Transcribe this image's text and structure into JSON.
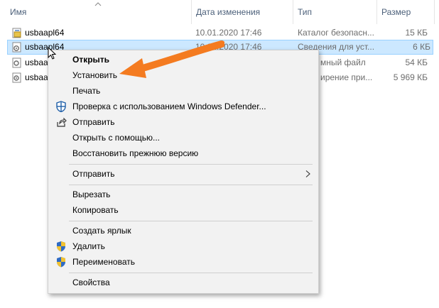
{
  "columns": {
    "name": "Имя",
    "date": "Дата изменения",
    "type": "Тип",
    "size": "Размер"
  },
  "files": [
    {
      "name": "usbaapl64",
      "date": "10.01.2020 17:46",
      "type": "Каталог безопасн...",
      "size": "15 КБ",
      "icon": "catalog-file-icon"
    },
    {
      "name": "usbaapl64",
      "date": "10.01.2020 17:46",
      "type": "Сведения для уст...",
      "size": "6 КБ",
      "icon": "setup-info-file-icon",
      "selected": true
    },
    {
      "name": "usbaa",
      "date": "",
      "type": "мный файл",
      "size": "54 КБ",
      "icon": "system-file-icon"
    },
    {
      "name": "usbaa",
      "date": "",
      "type": "ирение при...",
      "size": "5 969 КБ",
      "icon": "dll-file-icon"
    }
  ],
  "context_menu": {
    "open": "Открыть",
    "install": "Установить",
    "print": "Печать",
    "defender": "Проверка с использованием Windows Defender...",
    "share": "Отправить",
    "open_with": "Открыть с помощью...",
    "restore": "Восстановить прежнюю версию",
    "send_to": "Отправить",
    "cut": "Вырезать",
    "copy": "Копировать",
    "create_shortcut": "Создать ярлык",
    "delete": "Удалить",
    "rename": "Переименовать",
    "properties": "Свойства"
  },
  "colors": {
    "selection": "#cce8ff",
    "arrow": "#f47b20",
    "header_text": "#4c607a"
  }
}
